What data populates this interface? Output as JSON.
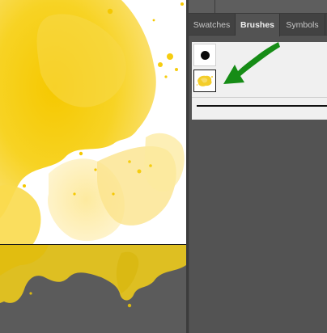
{
  "panel": {
    "tabs": [
      {
        "label": "Swatches",
        "active": false
      },
      {
        "label": "Brushes",
        "active": true
      },
      {
        "label": "Symbols",
        "active": false
      }
    ]
  },
  "brushes": [
    {
      "name": "round-brush",
      "icon": "black-dot-icon"
    },
    {
      "name": "watercolor-art-brush",
      "icon": "yellow-splash-icon",
      "selected": true
    }
  ],
  "annotation": {
    "icon": "green-arrow-icon",
    "color": "#1a8a1a"
  },
  "colors": {
    "paint_yellow": "#f7d21a",
    "panel_bg": "#535353",
    "tab_bar_bg": "#424242",
    "brush_area_bg": "#f0f0f0"
  }
}
